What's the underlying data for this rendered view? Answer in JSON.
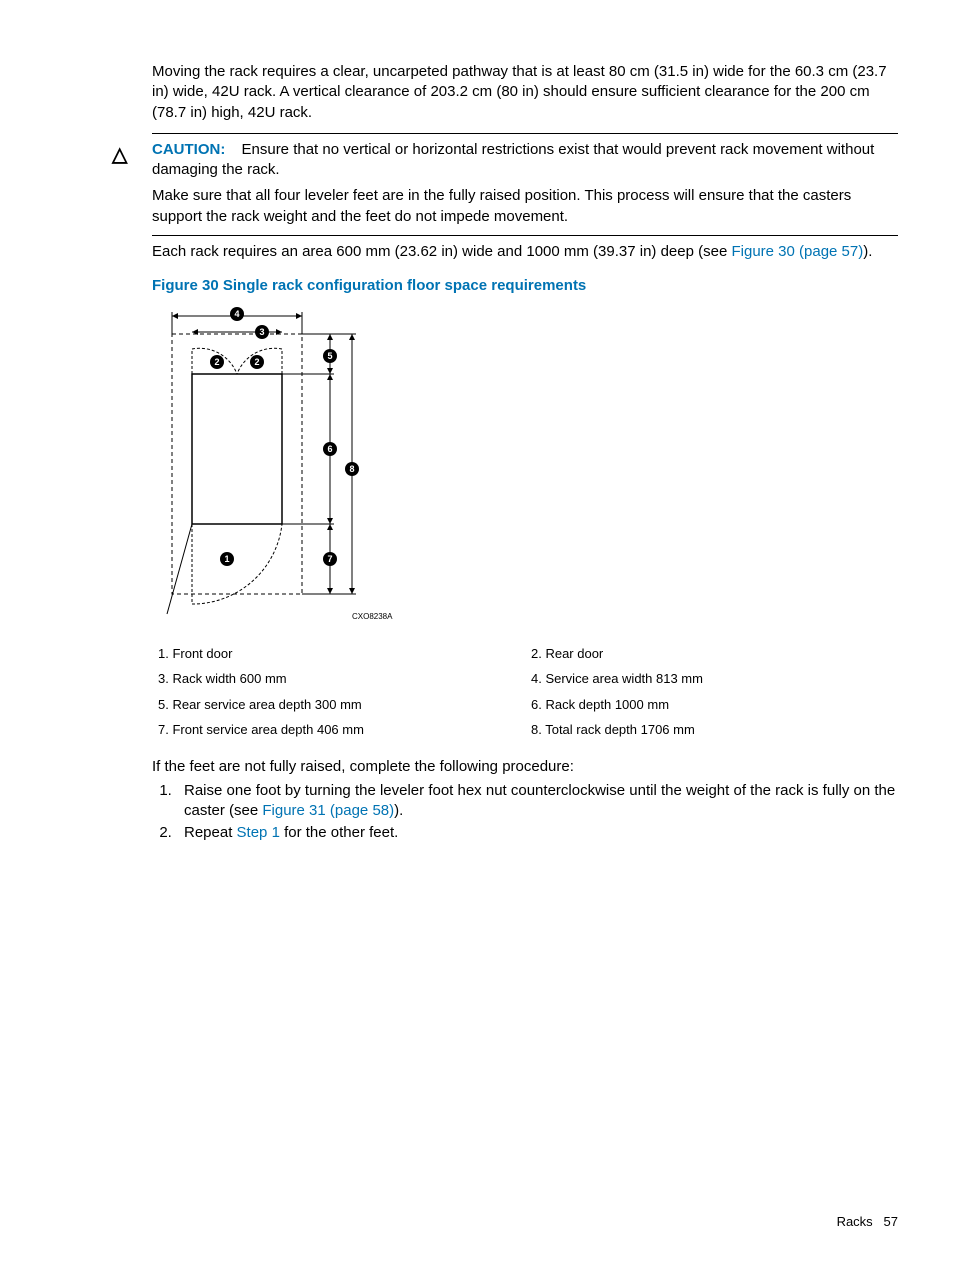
{
  "para1": "Moving the rack requires a clear, uncarpeted pathway that is at least 80 cm (31.5 in) wide for the 60.3 cm (23.7 in) wide, 42U rack. A vertical clearance of 203.2 cm (80 in) should ensure sufficient clearance for the 200 cm (78.7 in) high, 42U rack.",
  "caution": {
    "label": "CAUTION:",
    "text1": "Ensure that no vertical or horizontal restrictions exist that would prevent rack movement without damaging the rack.",
    "text2": "Make sure that all four leveler feet are in the fully raised position. This process will ensure that the casters support the rack weight and the feet do not impede movement."
  },
  "para2_pre": "Each rack requires an area 600 mm (23.62 in) wide and 1000 mm (39.37 in) deep (see ",
  "para2_link": "Figure 30 (page 57)",
  "para2_post": ").",
  "figure_title": "Figure 30 Single rack configuration floor space requirements",
  "figure_label": "CXO8238A",
  "legend": {
    "i1": "1. Front door",
    "i2": "2. Rear door",
    "i3": "3. Rack width 600 mm",
    "i4": "4. Service area width 813 mm",
    "i5": "5. Rear service area depth 300 mm",
    "i6": "6. Rack depth 1000 mm",
    "i7": "7. Front service area depth 406 mm",
    "i8": "8. Total rack depth 1706 mm"
  },
  "proc_intro": "If the feet are not fully raised, complete the following procedure:",
  "step1_pre": "Raise one foot by turning the leveler foot hex nut counterclockwise until the weight of the rack is fully on the caster (see ",
  "step1_link": "Figure 31 (page 58)",
  "step1_post": ").",
  "step2_pre": "Repeat ",
  "step2_link": "Step 1",
  "step2_post": " for the other feet.",
  "footer_section": "Racks",
  "footer_page": "57"
}
